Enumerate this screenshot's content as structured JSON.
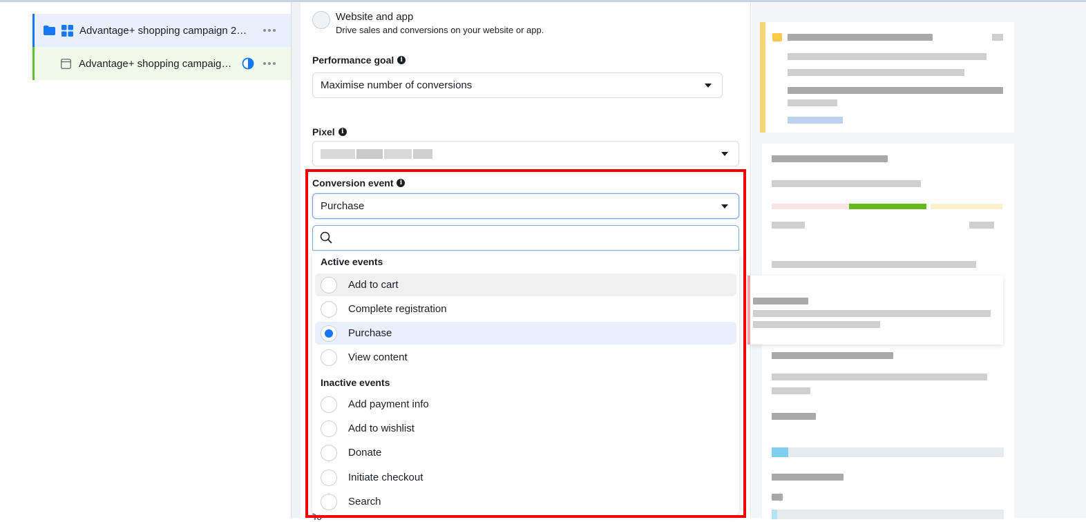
{
  "tree": {
    "campaign": {
      "label": "Advantage+ shopping campaign 22...",
      "icons": [
        "folder-icon",
        "grid-icon"
      ],
      "more": "more-options"
    },
    "adset": {
      "label": "Advantage+ shopping campaign ...",
      "icons": [
        "ad-set-icon",
        "half-circle-status-icon"
      ],
      "more": "more-options"
    }
  },
  "objective": {
    "title": "Website and app",
    "description": "Drive sales and conversions on your website or app."
  },
  "performance_goal": {
    "label": "Performance goal",
    "value": "Maximise number of conversions"
  },
  "pixel": {
    "label": "Pixel",
    "value": ""
  },
  "conversion_event": {
    "label": "Conversion event",
    "value": "Purchase",
    "search_placeholder": "",
    "groups": [
      {
        "heading": "Active events",
        "options": [
          {
            "label": "Add to cart",
            "selected": false,
            "hover": true
          },
          {
            "label": "Complete registration",
            "selected": false
          },
          {
            "label": "Purchase",
            "selected": true
          },
          {
            "label": "View content",
            "selected": false
          }
        ]
      },
      {
        "heading": "Inactive events",
        "options": [
          {
            "label": "Add payment info",
            "selected": false
          },
          {
            "label": "Add to wishlist",
            "selected": false
          },
          {
            "label": "Donate",
            "selected": false
          },
          {
            "label": "Initiate checkout",
            "selected": false
          },
          {
            "label": "Search",
            "selected": false
          }
        ]
      }
    ]
  },
  "bottom_partial_text": "To",
  "colors": {
    "accent": "#1877f2",
    "campaign_row_bg": "#e7f0fc",
    "adset_row_bg": "#f1f9ea",
    "adset_border": "#63be34",
    "highlight_box": "#f20000",
    "warning_bar": "#f7d47a",
    "progress_green": "#63b81a"
  }
}
